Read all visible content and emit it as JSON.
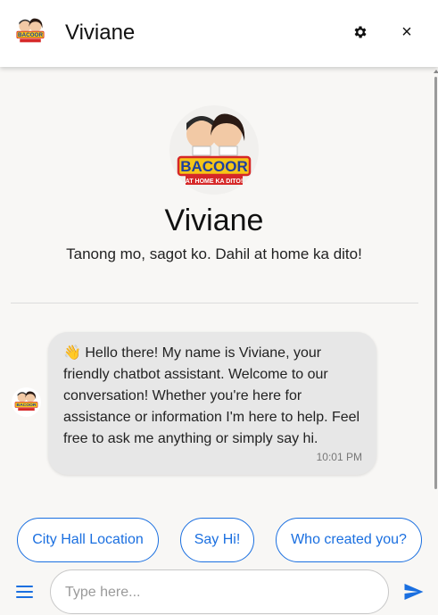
{
  "header": {
    "title": "Viviane",
    "settings_icon": "gear-icon",
    "close_icon": "close-icon",
    "close_glyph": "×"
  },
  "profile": {
    "name": "Viviane",
    "tagline": "Tanong mo, sagot ko. Dahil at home ka dito!",
    "logo_text": "BACOOR",
    "logo_banner": "AT HOME KA DITO!"
  },
  "messages": [
    {
      "sender": "bot",
      "emoji": "👋",
      "text": "Hello there! My name is Viviane, your friendly chatbot assistant. Welcome to our conversation! Whether you're here for assistance or information I'm here to help. Feel free to ask me anything or simply say hi.",
      "time": "10:01 PM"
    }
  ],
  "quick_replies": [
    {
      "label": "City Hall Location"
    },
    {
      "label": "Say Hi!"
    },
    {
      "label": "Who created you?"
    }
  ],
  "composer": {
    "placeholder": "Type here...",
    "value": "",
    "menu_icon": "menu-icon",
    "send_icon": "send-icon"
  },
  "colors": {
    "accent": "#1a6fe0",
    "bubble_bg": "#e7e7e7",
    "page_bg": "#f8f7f5",
    "logo_red": "#d62828",
    "logo_yellow": "#f5c518",
    "logo_blue": "#1d3fa0"
  }
}
